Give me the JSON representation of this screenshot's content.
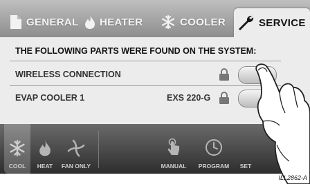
{
  "tabs": [
    {
      "label": "GENERAL"
    },
    {
      "label": "HEATER"
    },
    {
      "label": "COOLER"
    },
    {
      "label": "SERVICE",
      "active": true
    }
  ],
  "service": {
    "heading": "THE FOLLOWING PARTS WERE FOUND ON THE SYSTEM:",
    "rows": [
      {
        "label": "WIRELESS CONNECTION",
        "model": "",
        "locked": true
      },
      {
        "label": "EVAP COOLER 1",
        "model": "EXS 220-G",
        "locked": true
      }
    ]
  },
  "bottom_bar": {
    "modes": [
      {
        "label": "COOL",
        "active": true
      },
      {
        "label": "HEAT"
      },
      {
        "label": "FAN ONLY"
      },
      {
        "label": "MANUAL"
      },
      {
        "label": "PROGRAM"
      },
      {
        "label": "SET"
      }
    ]
  },
  "figure": {
    "caption": "ILL2862-A"
  },
  "icons": [
    "document-icon",
    "flame-icon",
    "snowflake-icon",
    "wrench-icon",
    "lock-icon",
    "fan-icon",
    "touch-hand-icon",
    "clock-icon"
  ]
}
